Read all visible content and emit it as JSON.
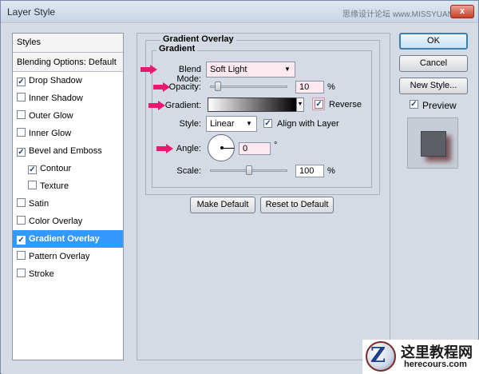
{
  "window": {
    "title": "Layer Style",
    "watermark_top": "思缘设计论坛 www.MISSYUAN.COM",
    "close_label": "x"
  },
  "styles_list": {
    "header": "Styles",
    "blending_options": "Blending Options: Default",
    "items": [
      {
        "label": "Drop Shadow",
        "checked": true,
        "selected": false,
        "indent": false
      },
      {
        "label": "Inner Shadow",
        "checked": false,
        "selected": false,
        "indent": false
      },
      {
        "label": "Outer Glow",
        "checked": false,
        "selected": false,
        "indent": false
      },
      {
        "label": "Inner Glow",
        "checked": false,
        "selected": false,
        "indent": false
      },
      {
        "label": "Bevel and Emboss",
        "checked": true,
        "selected": false,
        "indent": false
      },
      {
        "label": "Contour",
        "checked": true,
        "selected": false,
        "indent": true
      },
      {
        "label": "Texture",
        "checked": false,
        "selected": false,
        "indent": true
      },
      {
        "label": "Satin",
        "checked": false,
        "selected": false,
        "indent": false
      },
      {
        "label": "Color Overlay",
        "checked": false,
        "selected": false,
        "indent": false
      },
      {
        "label": "Gradient Overlay",
        "checked": true,
        "selected": true,
        "indent": false
      },
      {
        "label": "Pattern Overlay",
        "checked": false,
        "selected": false,
        "indent": false
      },
      {
        "label": "Stroke",
        "checked": false,
        "selected": false,
        "indent": false
      }
    ]
  },
  "panel": {
    "group_title": "Gradient Overlay",
    "subgroup_title": "Gradient",
    "blend_mode_label": "Blend Mode:",
    "blend_mode_value": "Soft Light",
    "opacity_label": "Opacity:",
    "opacity_value": "10",
    "opacity_unit": "%",
    "opacity_level": 0.1,
    "gradient_label": "Gradient:",
    "reverse_label": "Reverse",
    "reverse_checked": true,
    "style_label": "Style:",
    "style_value": "Linear",
    "align_label": "Align with Layer",
    "align_checked": true,
    "angle_label": "Angle:",
    "angle_value": "0",
    "angle_unit": "°",
    "scale_label": "Scale:",
    "scale_value": "100",
    "scale_unit": "%",
    "scale_level": 0.5,
    "make_default": "Make Default",
    "reset_default": "Reset to Default"
  },
  "buttons": {
    "ok": "OK",
    "cancel": "Cancel",
    "new_style": "New Style...",
    "preview_label": "Preview",
    "preview_checked": true
  },
  "logo": {
    "letter": "Z",
    "chinese": "这里教程网",
    "url": "herecours.com"
  },
  "colors": {
    "highlight_field": "#ffe9f1",
    "selection": "#3399ff",
    "annotation_arrow": "#e8196e"
  }
}
